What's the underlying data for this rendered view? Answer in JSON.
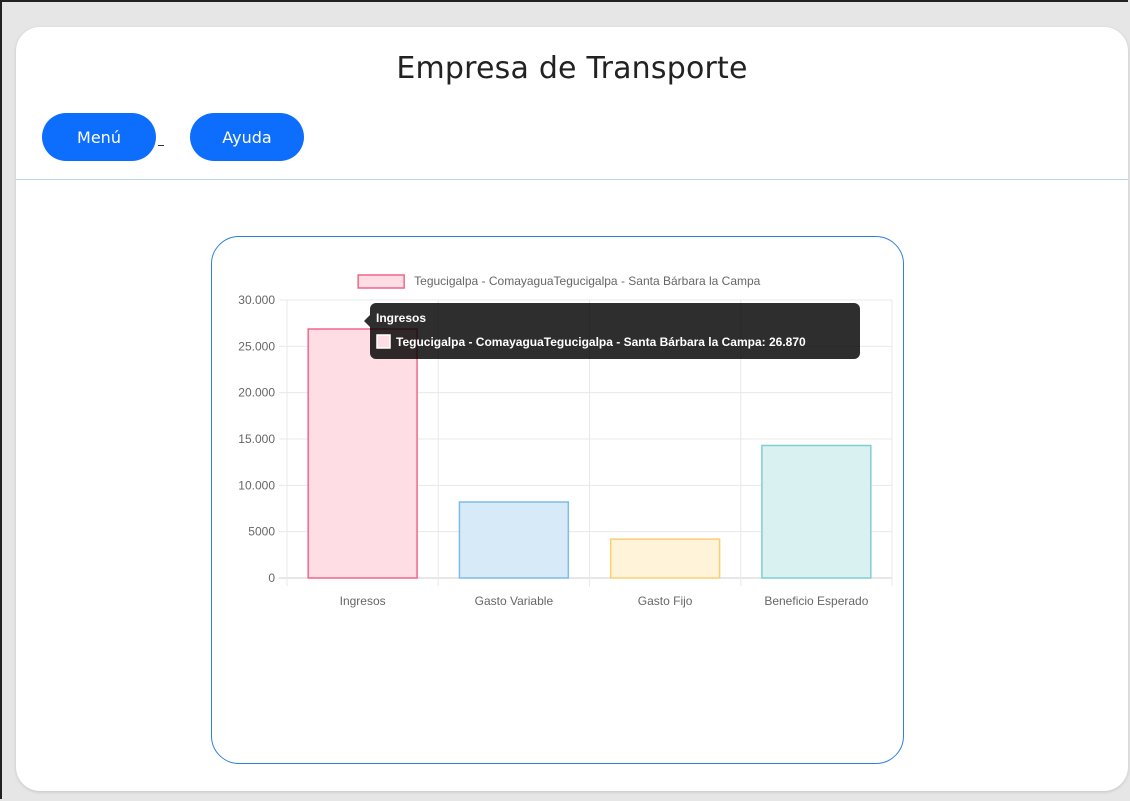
{
  "header": {
    "title": "Empresa de Transporte"
  },
  "nav": {
    "menu_label": "Menú",
    "ayuda_label": "Ayuda"
  },
  "chart_data": {
    "type": "bar",
    "categories": [
      "Ingresos",
      "Gasto Variable",
      "Gasto Fijo",
      "Beneficio Esperado"
    ],
    "series": [
      {
        "name": "Tegucigalpa - ComayaguaTegucigalpa - Santa Bárbara la Campa",
        "values": [
          26870,
          8200,
          4200,
          14300
        ]
      }
    ],
    "colors": {
      "fill": [
        "#ffdde4",
        "#d6eaf8",
        "#fff3da",
        "#d9f1f1"
      ],
      "stroke": [
        "#f0678a",
        "#7fbbe9",
        "#f9cf76",
        "#7fcfcf"
      ]
    },
    "ylim": [
      0,
      30000
    ],
    "yticks": [
      0,
      5000,
      10000,
      15000,
      20000,
      25000,
      30000
    ],
    "ytick_labels": [
      "0",
      "5000",
      "10.000",
      "15.000",
      "20.000",
      "25.000",
      "30.000"
    ],
    "grid": true,
    "legend_position": "top",
    "tooltip": {
      "title": "Ingresos",
      "body": "Tegucigalpa - ComayaguaTegucigalpa - Santa Bárbara la Campa: 26.870"
    }
  }
}
